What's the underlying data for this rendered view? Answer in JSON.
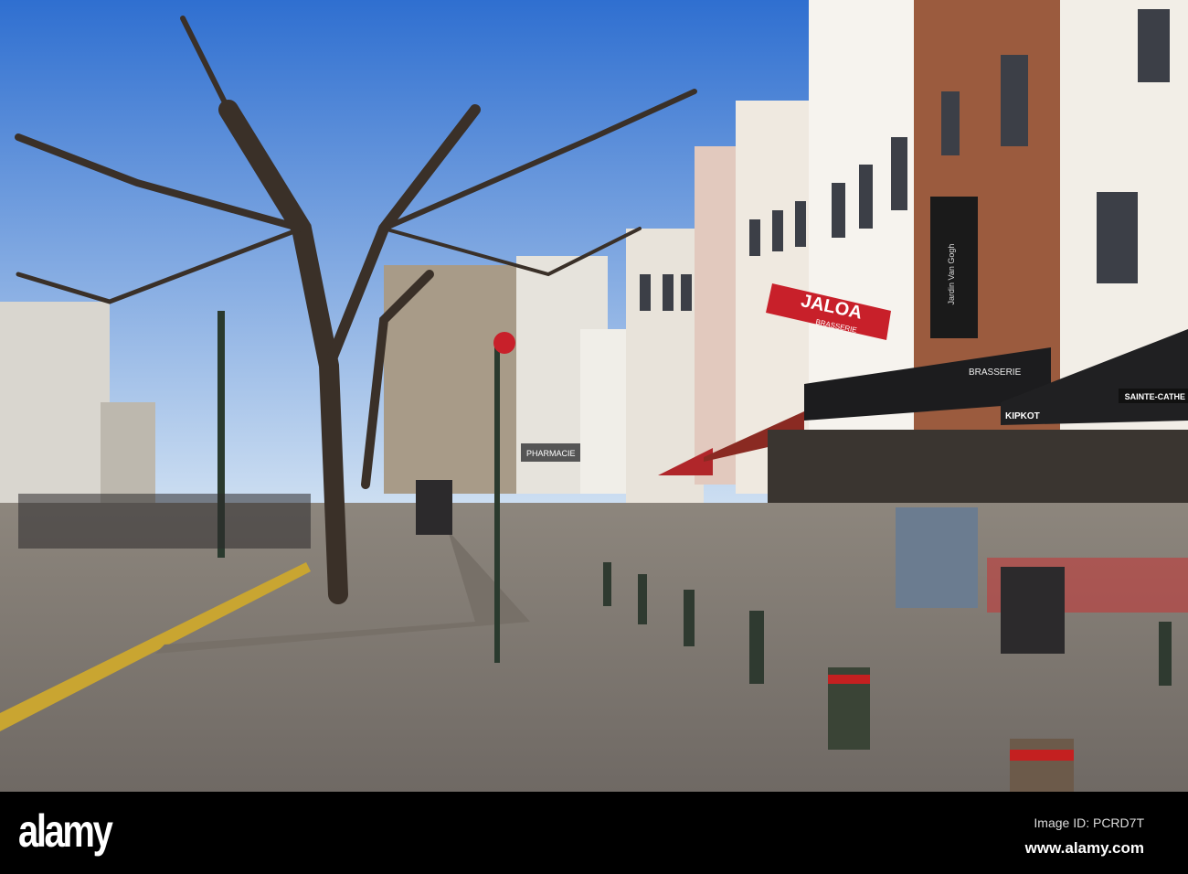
{
  "photo": {
    "signs": {
      "jaloa": "JALOA",
      "jaloa_sub": "BRASSERIE",
      "brasserie": "BRASSERIE",
      "jardin": "Jardin Van Gogh",
      "kipkot": "KIPKOT",
      "pharmacie": "PHARMACIE",
      "sainte": "SAINTE-CATHE"
    }
  },
  "watermark": {
    "logo": "alamy",
    "image_id": "Image ID: PCRD7T",
    "url": "www.alamy.com"
  }
}
